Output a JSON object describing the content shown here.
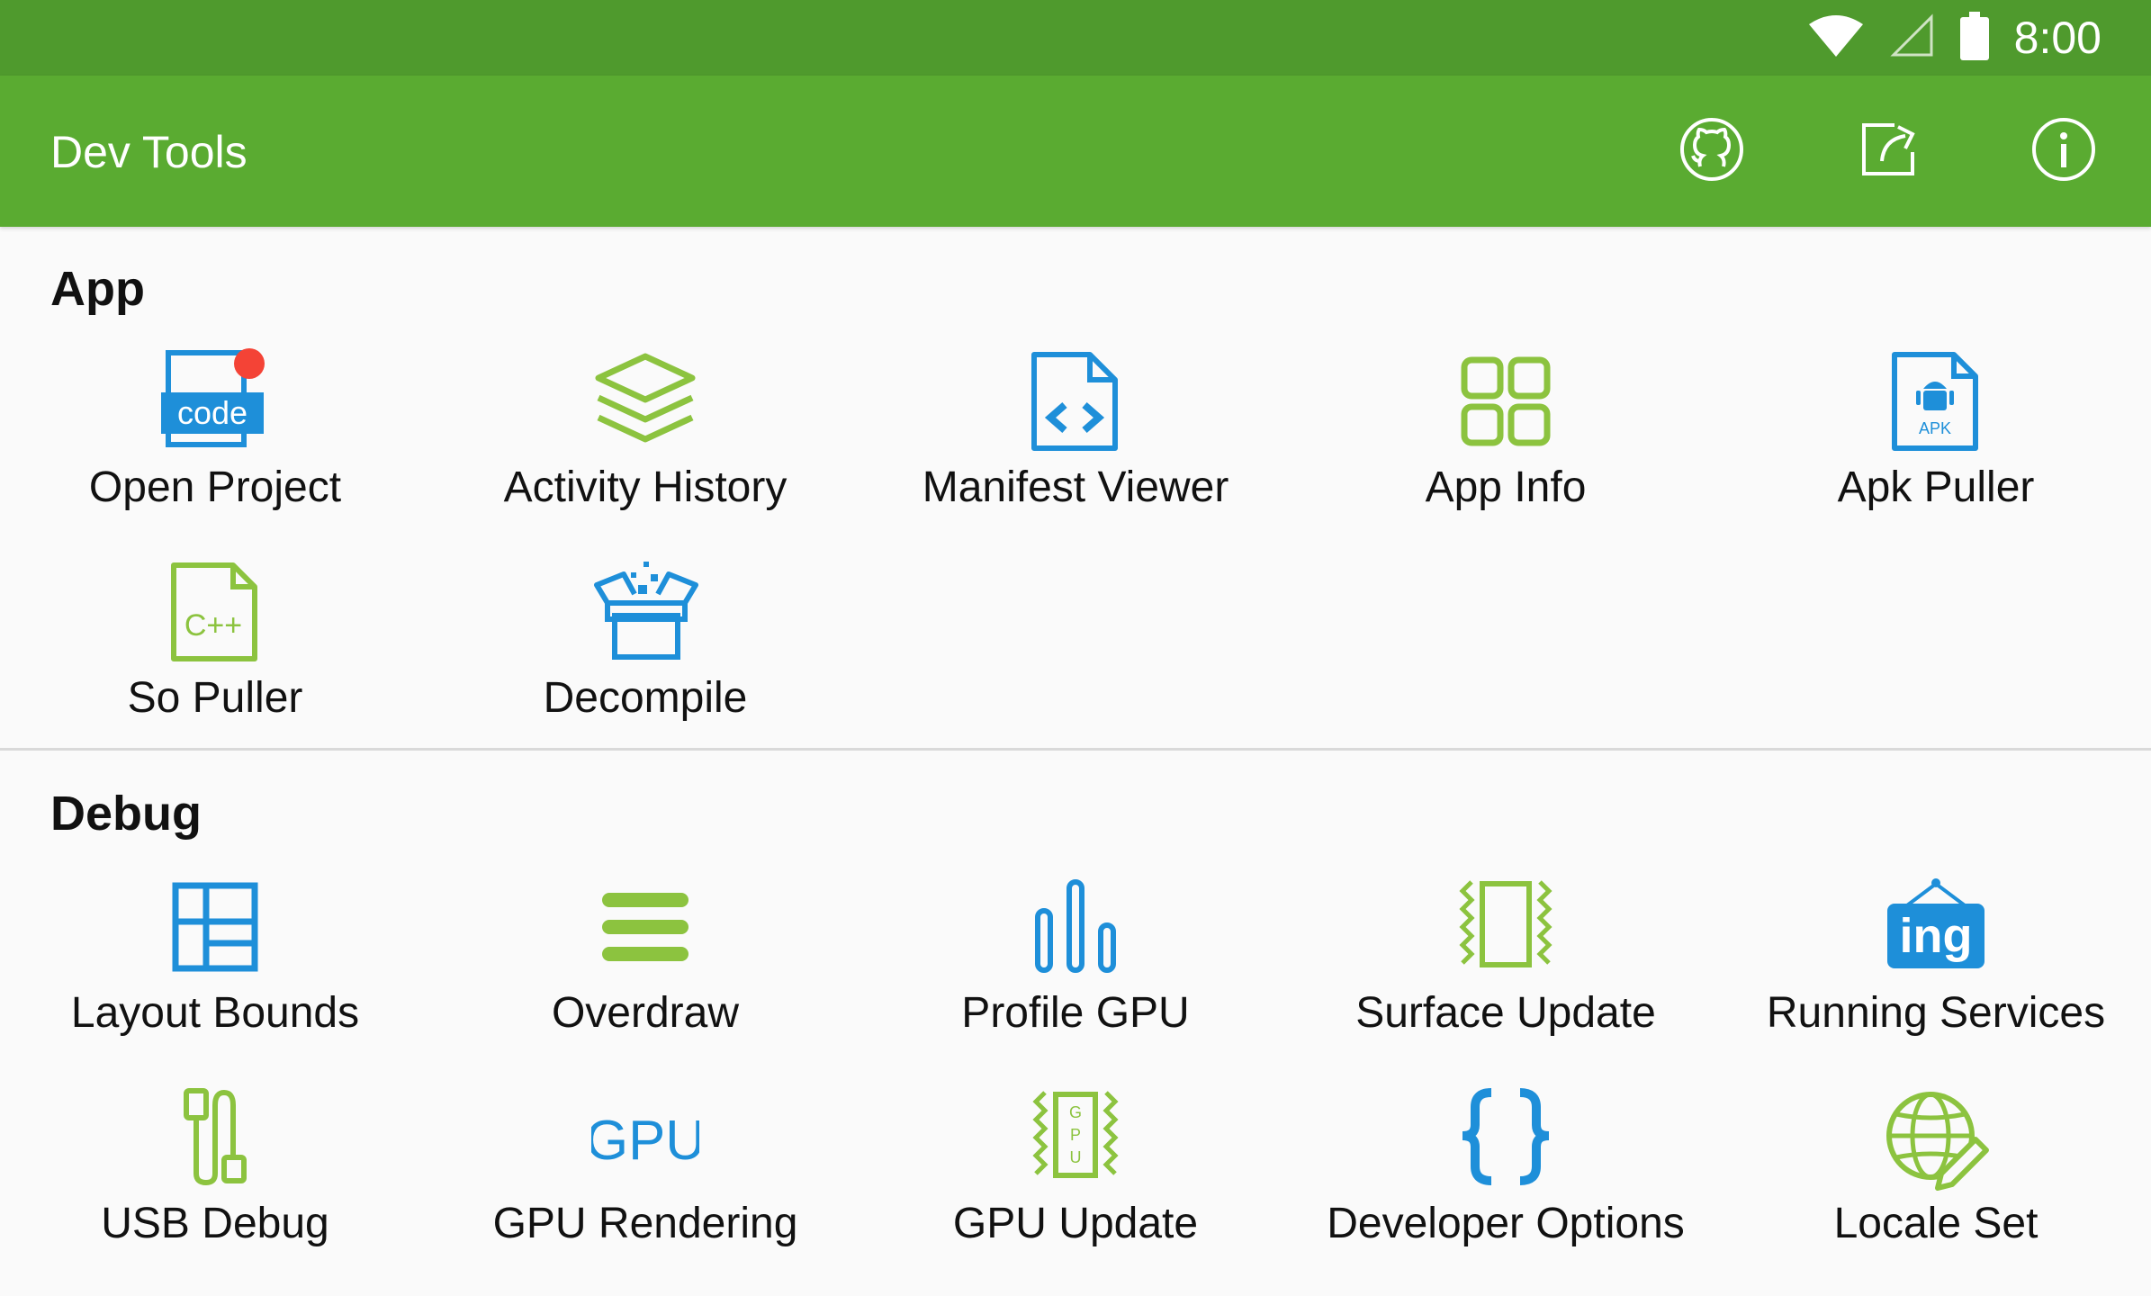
{
  "status_bar": {
    "time": "8:00"
  },
  "app_bar": {
    "title": "Dev Tools",
    "actions": [
      "github-icon",
      "share-icon",
      "info-icon"
    ]
  },
  "sections": {
    "app": {
      "title": "App",
      "items": [
        {
          "label": "Open Project",
          "icon": "code-file-icon",
          "badge_color": "#f44336",
          "icon_text": "code"
        },
        {
          "label": "Activity History",
          "icon": "layers-icon"
        },
        {
          "label": "Manifest Viewer",
          "icon": "manifest-file-icon"
        },
        {
          "label": "App Info",
          "icon": "grid-icon"
        },
        {
          "label": "Apk Puller",
          "icon": "apk-file-icon",
          "icon_text": "APK"
        },
        {
          "label": "So Puller",
          "icon": "cpp-file-icon",
          "icon_text": "C++"
        },
        {
          "label": "Decompile",
          "icon": "open-box-icon"
        }
      ]
    },
    "debug": {
      "title": "Debug",
      "items": [
        {
          "label": "Layout Bounds",
          "icon": "layout-bounds-icon"
        },
        {
          "label": "Overdraw",
          "icon": "overdraw-icon"
        },
        {
          "label": "Profile GPU",
          "icon": "bar-chart-icon"
        },
        {
          "label": "Surface Update",
          "icon": "surface-update-icon"
        },
        {
          "label": "Running Services",
          "icon": "ing-sign-icon",
          "icon_text": "ing"
        },
        {
          "label": "USB Debug",
          "icon": "usb-cable-icon"
        },
        {
          "label": "GPU Rendering",
          "icon": "gpu-text-icon",
          "icon_text": "GPU"
        },
        {
          "label": "GPU Update",
          "icon": "gpu-update-icon",
          "icon_text": "GPU"
        },
        {
          "label": "Developer Options",
          "icon": "braces-icon"
        },
        {
          "label": "Locale Set",
          "icon": "globe-edit-icon"
        }
      ]
    }
  },
  "colors": {
    "green": "#8cc33f",
    "blue": "#1e8fd9",
    "appbar": "#5aab31",
    "statusbar": "#4f9a2d"
  }
}
